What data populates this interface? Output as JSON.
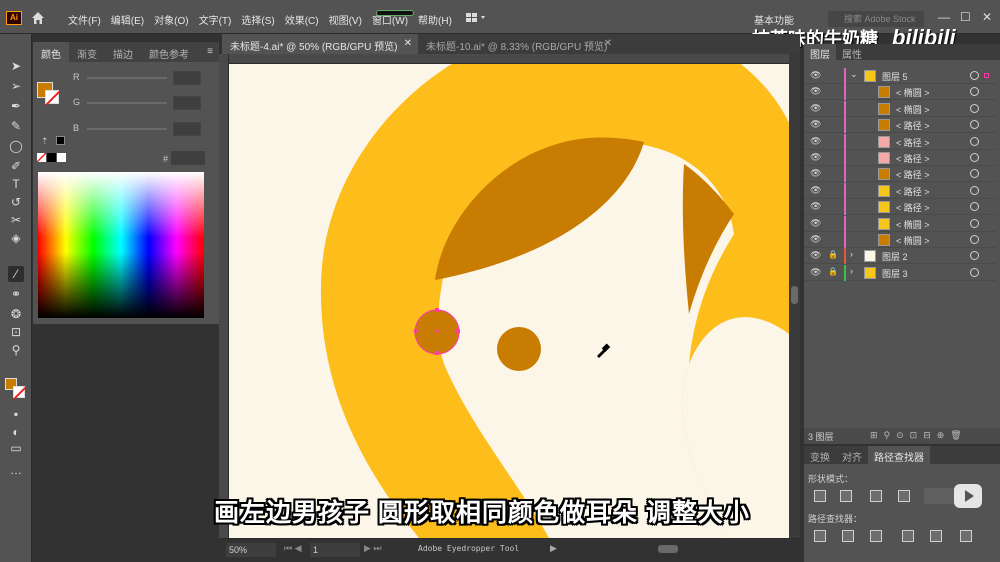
{
  "app": {
    "logo": "Ai",
    "menu": [
      "文件(F)",
      "编辑(E)",
      "对象(O)",
      "文字(T)",
      "选择(S)",
      "效果(C)",
      "视图(V)",
      "窗口(W)",
      "帮助(H)"
    ],
    "workspace": "基本功能",
    "search_placeholder": "搜索 Adobe Stock"
  },
  "tabs": [
    {
      "label": "未标题-4.ai* @ 50% (RGB/GPU 预览)",
      "active": true
    },
    {
      "label": "未标题-10.ai* @ 8.33% (RGB/GPU 预览)",
      "active": false
    }
  ],
  "color_panel": {
    "tabs": [
      "颜色",
      "渐变",
      "描边",
      "颜色参考"
    ],
    "channels": [
      "R",
      "G",
      "B"
    ],
    "hex_label": "#",
    "fill_color": "#c87d02",
    "stroke": "none"
  },
  "status": {
    "zoom": "50%",
    "page": "1",
    "tool_name": "Adobe Eyedropper Tool"
  },
  "layers_panel": {
    "tabs": [
      "图层",
      "属性"
    ],
    "rows": [
      {
        "name": "图层 5",
        "level": 0,
        "expanded": true,
        "locked": false,
        "bar": "#e063c8",
        "thumb": "#f6c71a"
      },
      {
        "name": "< 椭圆 >",
        "level": 1,
        "locked": false,
        "bar": "#e063c8",
        "thumb": "#c87d02"
      },
      {
        "name": "< 椭圆 >",
        "level": 1,
        "locked": false,
        "bar": "#e063c8",
        "thumb": "#c87d02"
      },
      {
        "name": "< 路径 >",
        "level": 1,
        "locked": false,
        "bar": "#e063c8",
        "thumb": "#c87d02"
      },
      {
        "name": "< 路径 >",
        "level": 1,
        "locked": false,
        "bar": "#e063c8",
        "thumb": "#f4a8a8"
      },
      {
        "name": "< 路径 >",
        "level": 1,
        "locked": false,
        "bar": "#e063c8",
        "thumb": "#f4a8a8"
      },
      {
        "name": "< 路径 >",
        "level": 1,
        "locked": false,
        "bar": "#e063c8",
        "thumb": "#c87d02"
      },
      {
        "name": "< 路径 >",
        "level": 1,
        "locked": false,
        "bar": "#e063c8",
        "thumb": "#f6c71a"
      },
      {
        "name": "< 路径 >",
        "level": 1,
        "locked": false,
        "bar": "#e063c8",
        "thumb": "#f6c71a"
      },
      {
        "name": "< 椭圆 >",
        "level": 1,
        "locked": false,
        "bar": "#e063c8",
        "thumb": "#f6c71a"
      },
      {
        "name": "< 椭圆 >",
        "level": 1,
        "locked": false,
        "bar": "#e063c8",
        "thumb": "#c87d02"
      },
      {
        "name": "图层 2",
        "level": 0,
        "expanded": false,
        "locked": true,
        "bar": "#e05b3c",
        "thumb": "#fcf6e8"
      },
      {
        "name": "图层 3",
        "level": 0,
        "expanded": false,
        "locked": true,
        "bar": "#3cc04a",
        "thumb": "#f6c71a"
      }
    ],
    "footer_count": "3 图层"
  },
  "bottom_panel": {
    "tabs": [
      "变换",
      "对齐",
      "路径查找器"
    ],
    "shape_modes_label": "形状模式：",
    "pathfinder_label": "路径查找器："
  },
  "subtitle": "画左边男孩子  圆形取相同颜色做耳朵  调整大小",
  "watermark": {
    "text": "抹茶味的牛奶糖_",
    "brand": "bilibili"
  },
  "colors": {
    "canvas": "#fcf6e8",
    "yellow": "#fdbd1b",
    "brown": "#c87d02",
    "selection": "#ff3aa6"
  }
}
